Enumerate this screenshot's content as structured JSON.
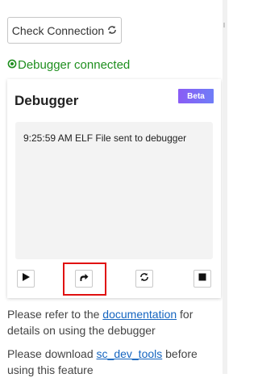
{
  "check_connection": {
    "label": "Check Connection",
    "icon": "refresh-icon"
  },
  "status": {
    "text": "Debugger connected",
    "icon": "connected-circle-icon",
    "color": "#1f8f1f"
  },
  "debugger": {
    "title": "Debugger",
    "badge": "Beta",
    "log_lines": [
      "9:25:59 AM ELF File sent to debugger"
    ],
    "controls": [
      {
        "name": "play",
        "icon": "play-icon"
      },
      {
        "name": "step-over",
        "icon": "redo-arrow-icon"
      },
      {
        "name": "restart",
        "icon": "refresh-icon"
      },
      {
        "name": "stop",
        "icon": "stop-icon"
      }
    ]
  },
  "info": {
    "line1_pre": "Please refer to the ",
    "line1_link": "documentation",
    "line1_post": " for details on using the debugger",
    "line2_pre": "Please download ",
    "line2_link": "sc_dev_tools",
    "line2_post": " before using this feature"
  }
}
